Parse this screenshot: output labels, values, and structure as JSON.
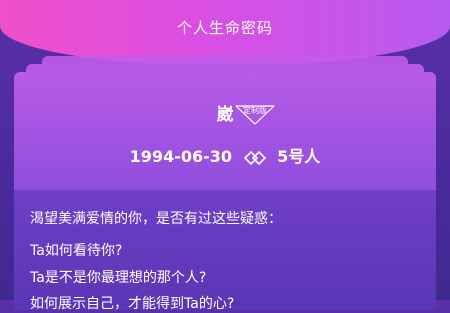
{
  "header": {
    "title": "个人生命密码"
  },
  "profile": {
    "name": "崴",
    "badge": "定制版",
    "birthdate": "1994-06-30",
    "number_label": "5号人"
  },
  "questions": {
    "intro": "渴望美满爱情的你，是否有过这些疑惑：",
    "items": [
      "Ta如何看待你?",
      "Ta是不是你最理想的那个人?",
      "如何展示自己，才能得到Ta的心?"
    ]
  },
  "icons": {
    "link": "double-diamond-link-icon"
  },
  "colors": {
    "hero_gradient_start": "#f050c8",
    "hero_gradient_end": "#b85bf0",
    "card_top": "#b95ae8",
    "card_bottom": "#5a36b3",
    "background": "#4a2a9c"
  }
}
